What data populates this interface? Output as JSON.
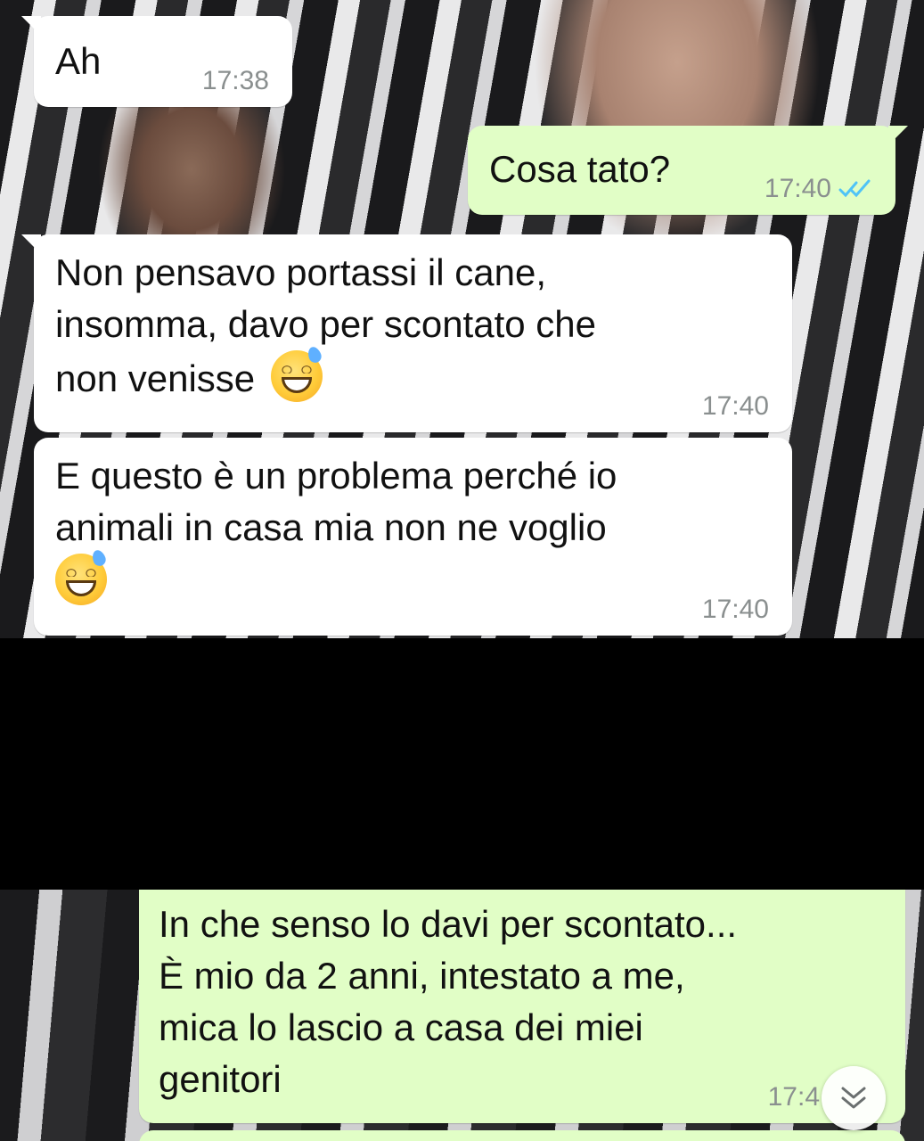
{
  "messages": {
    "m1": {
      "text": "Ah",
      "time": "17:38"
    },
    "m2": {
      "text": "Cosa tato?",
      "time": "17:40"
    },
    "m3": {
      "text": "Non pensavo portassi il cane,\ninsomma, davo per scontato che\nnon venisse",
      "time": "17:40",
      "emoji": "grinning-sweat-emoji"
    },
    "m4": {
      "text": "E questo è un problema perché io\nanimali in casa mia non ne voglio",
      "time": "17:40",
      "emoji": "grinning-sweat-emoji"
    },
    "m5": {
      "text": "In che senso lo davi per scontato...\nÈ mio da 2 anni, intestato a me,\nmica lo lascio a casa dei miei\ngenitori",
      "time": "17:4"
    }
  },
  "colors": {
    "incoming_bubble": "#ffffff",
    "outgoing_bubble": "#e1fec6",
    "read_ticks": "#4fc3f7",
    "timestamp": "#8a8f8f"
  },
  "icons": {
    "read_receipt": "double-check-icon",
    "scroll_down": "chevron-double-down-icon"
  }
}
